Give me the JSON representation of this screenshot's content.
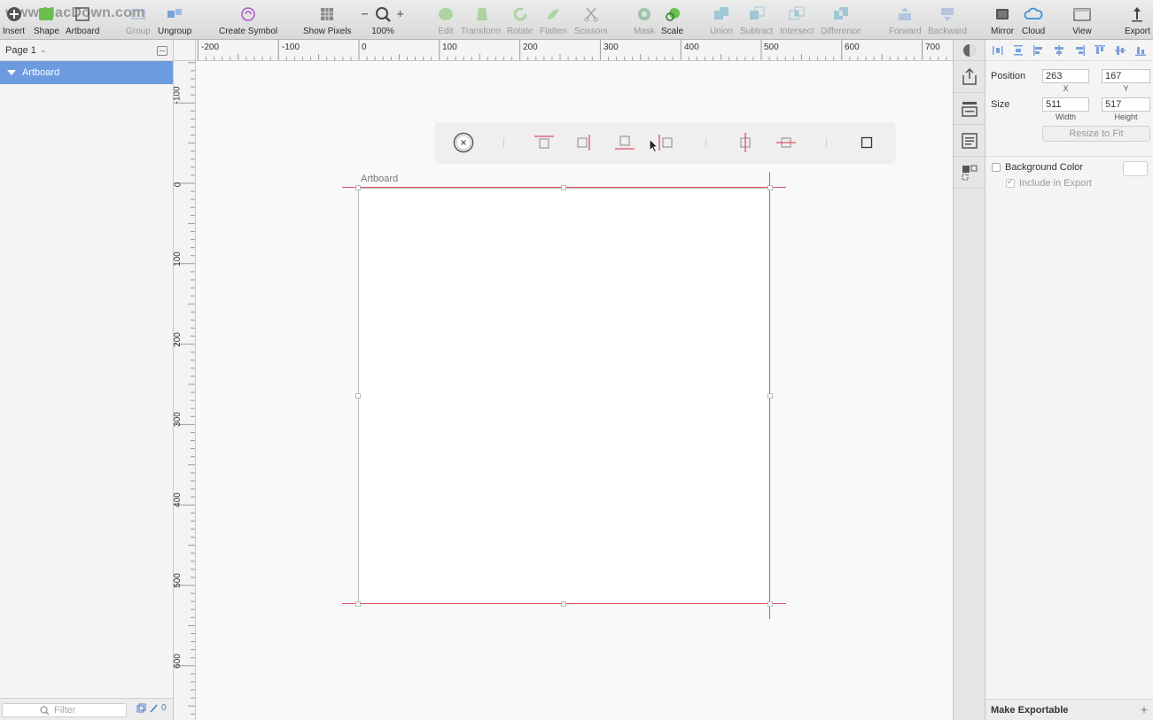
{
  "toolbar": {
    "watermark": "www.MacDown.com",
    "items": [
      {
        "label": "Insert",
        "icon": "insert-icon"
      },
      {
        "label": "Shape",
        "icon": "shape-icon"
      },
      {
        "label": "Artboard",
        "icon": "artboard-icon"
      },
      {
        "label": "Group",
        "icon": "group-icon",
        "disabled": true
      },
      {
        "label": "Ungroup",
        "icon": "ungroup-icon"
      },
      {
        "label": "Create Symbol",
        "icon": "create-symbol-icon"
      },
      {
        "label": "Show Pixels",
        "icon": "show-pixels-icon"
      },
      {
        "label": "100%",
        "icon": "zoom-icon"
      },
      {
        "label": "Edit",
        "icon": "edit-icon",
        "disabled": true
      },
      {
        "label": "Transform",
        "icon": "transform-icon",
        "disabled": true
      },
      {
        "label": "Rotate",
        "icon": "rotate-icon",
        "disabled": true
      },
      {
        "label": "Flatten",
        "icon": "flatten-icon",
        "disabled": true
      },
      {
        "label": "Scissors",
        "icon": "scissors-icon",
        "disabled": true
      },
      {
        "label": "Mask",
        "icon": "mask-icon",
        "disabled": true
      },
      {
        "label": "Scale",
        "icon": "scale-icon"
      },
      {
        "label": "Union",
        "icon": "union-icon",
        "disabled": true
      },
      {
        "label": "Subtract",
        "icon": "subtract-icon",
        "disabled": true
      },
      {
        "label": "Intersect",
        "icon": "intersect-icon",
        "disabled": true
      },
      {
        "label": "Difference",
        "icon": "difference-icon",
        "disabled": true
      },
      {
        "label": "Forward",
        "icon": "forward-icon",
        "disabled": true
      },
      {
        "label": "Backward",
        "icon": "backward-icon",
        "disabled": true
      },
      {
        "label": "Mirror",
        "icon": "mirror-icon"
      },
      {
        "label": "Cloud",
        "icon": "cloud-icon"
      },
      {
        "label": "View",
        "icon": "view-icon"
      },
      {
        "label": "Export",
        "icon": "export-icon"
      }
    ]
  },
  "left_panel": {
    "page_selector": "Page 1",
    "layers": [
      {
        "name": "Artboard",
        "selected": true,
        "expanded": true
      }
    ],
    "filter_placeholder": "Filter",
    "edited_count": "0"
  },
  "rulers": {
    "top_labels": [
      "-200",
      "-100",
      "0",
      "100",
      "200",
      "300",
      "400",
      "500",
      "600",
      "700"
    ],
    "left_labels": [
      "-100",
      "0",
      "100",
      "200",
      "300",
      "400",
      "500",
      "600"
    ]
  },
  "canvas": {
    "artboard_name": "Artboard"
  },
  "inspector": {
    "position_label": "Position",
    "position_x": "263",
    "position_y": "167",
    "x_label": "X",
    "y_label": "Y",
    "size_label": "Size",
    "width": "511",
    "height": "517",
    "width_label": "Width",
    "height_label": "Height",
    "resize_to_fit": "Resize to Fit",
    "background_color_label": "Background Color",
    "include_in_export_label": "Include in Export",
    "make_exportable": "Make Exportable"
  },
  "colors": {
    "accent": "#6c9be0",
    "guide": "#e05060"
  }
}
